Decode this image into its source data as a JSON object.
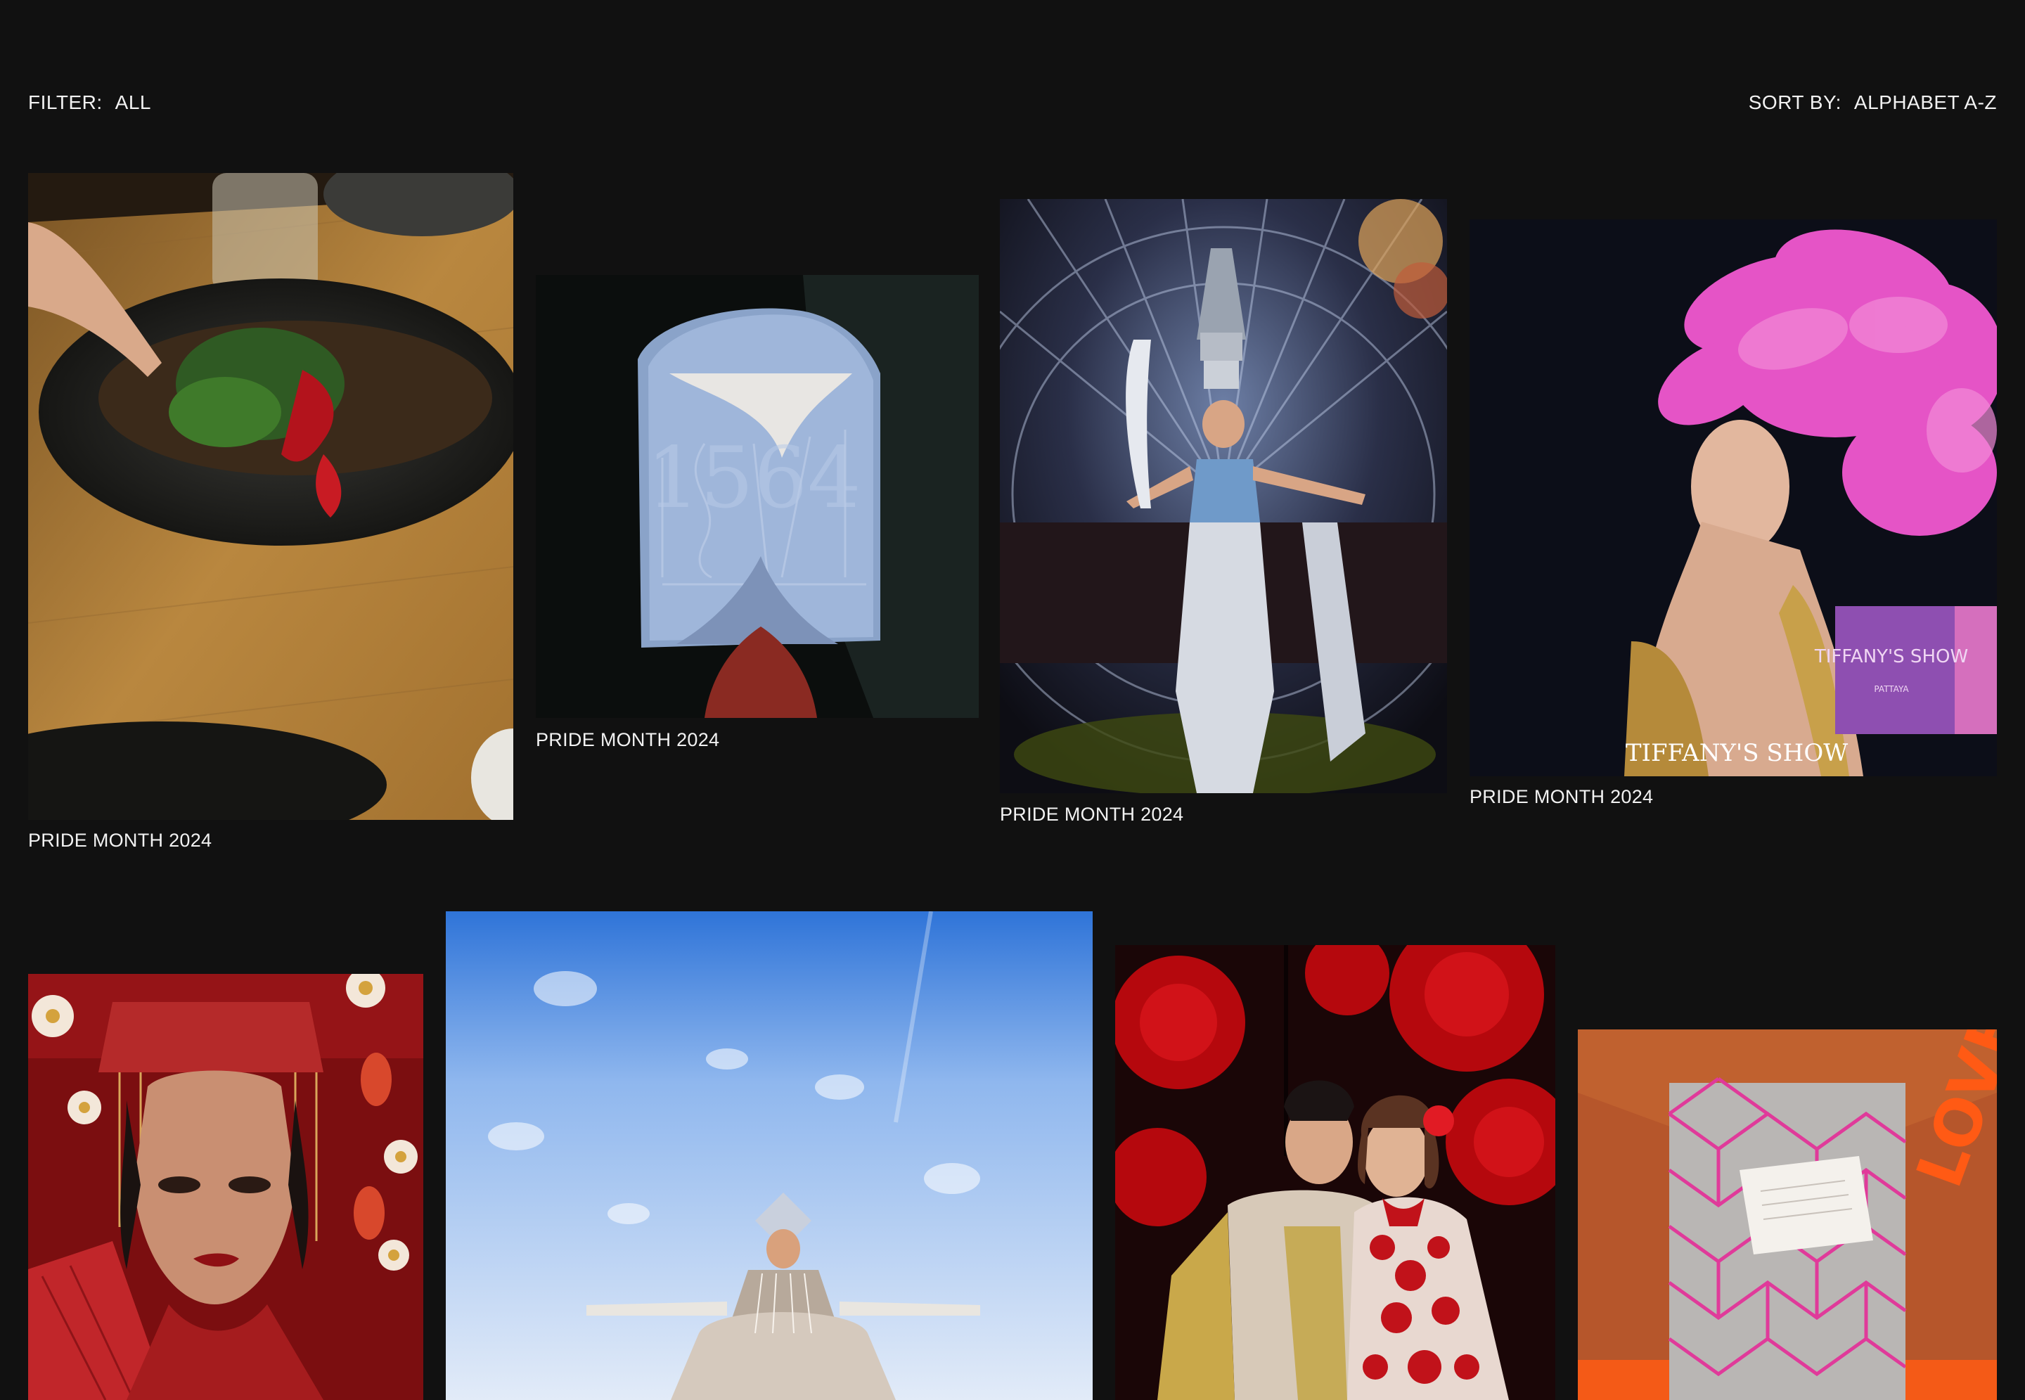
{
  "toolbar": {
    "filter_label": "FILTER:",
    "filter_value": "ALL",
    "sort_label": "SORT BY:",
    "sort_value": "ALPHABET A-Z"
  },
  "projects": [
    {
      "caption": "PRIDE MONTH 2024",
      "image": "restaurant-fish-dish"
    },
    {
      "caption": "PRIDE MONTH 2024",
      "image": "blue-ticket-card"
    },
    {
      "caption": "PRIDE MONTH 2024",
      "image": "cabaret-performer-stage"
    },
    {
      "caption": "PRIDE MONTH 2024",
      "image": "pink-feather-headdress"
    },
    {
      "caption": "",
      "image": "chinese-bride-portrait"
    },
    {
      "caption": "",
      "image": "performer-blue-sky"
    },
    {
      "caption": "",
      "image": "couple-red-roses"
    },
    {
      "caption": "",
      "image": "orange-envelope-card"
    }
  ],
  "logo_text": {
    "tiffany_badge": "TIFFANY'S SHOW",
    "tiffany_badge_sub": "PATTAYA",
    "tiffany_watermark": "TIFFANY'S SHOW",
    "ticket_numerals": "1564",
    "envelope_text": "LOVE"
  }
}
